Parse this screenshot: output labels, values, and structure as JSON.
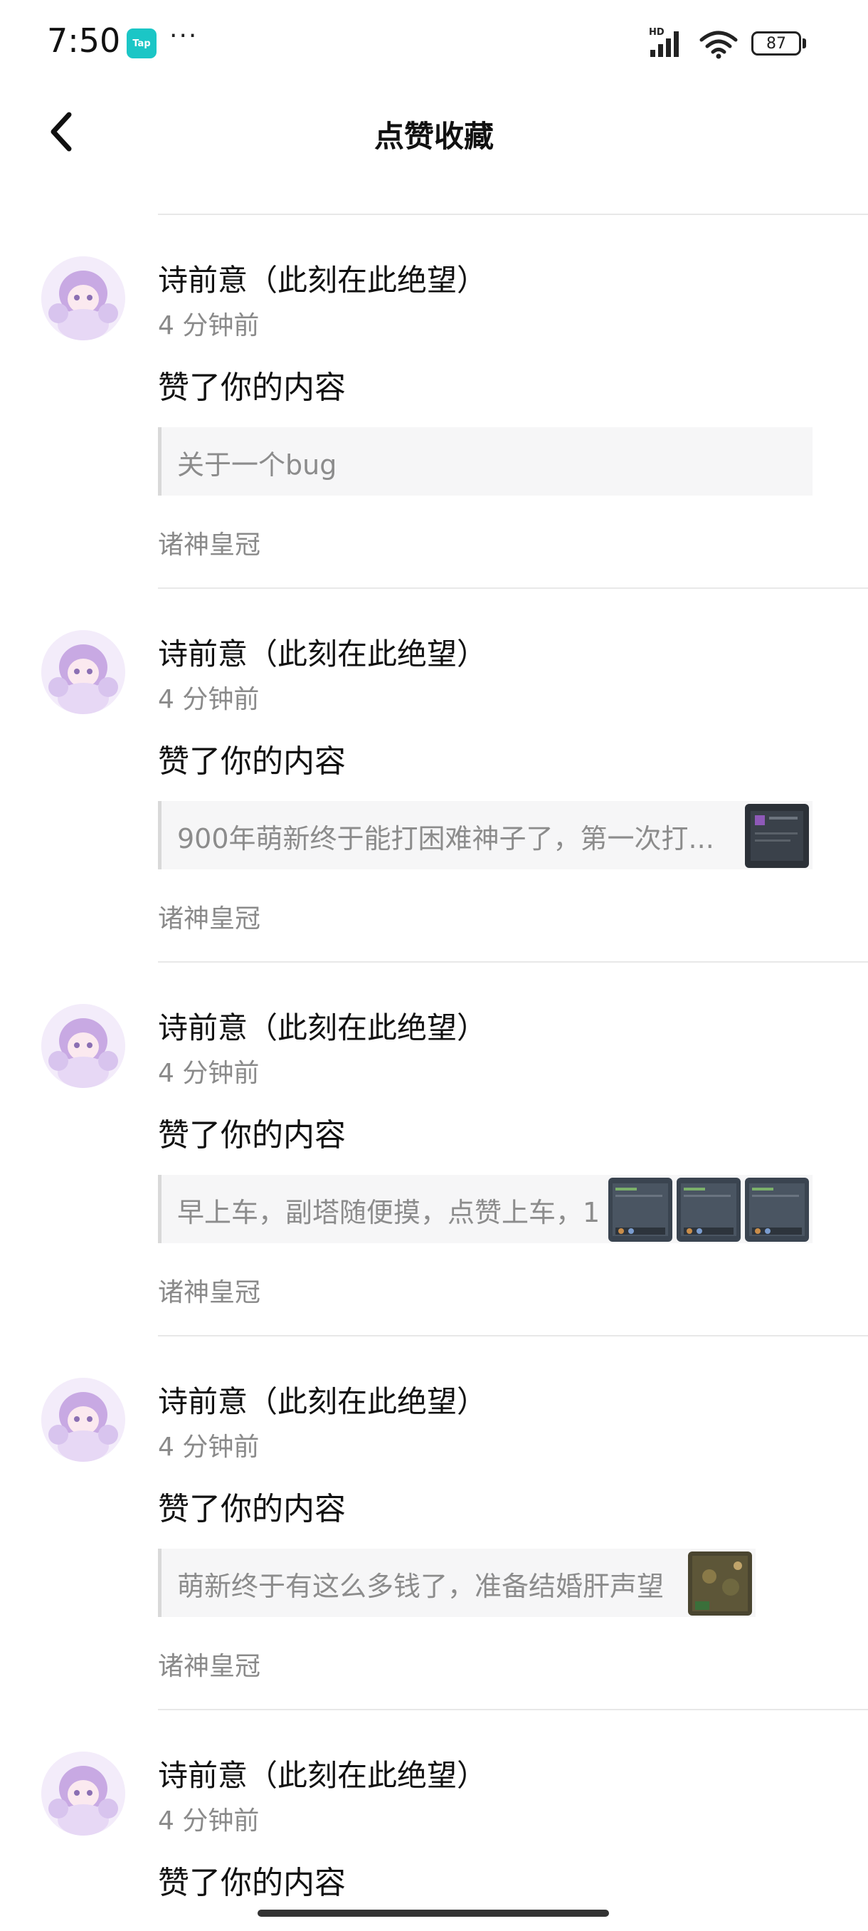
{
  "status_bar": {
    "time": "7:50",
    "app_badge": "Tap",
    "more": "···",
    "signal_label": "HD",
    "battery": "87"
  },
  "header": {
    "title": "点赞收藏"
  },
  "notifications": [
    {
      "user": "诗前意（此刻在此绝望）",
      "time": "4 分钟前",
      "action": "赞了你的内容",
      "quote": "关于一个bug",
      "game": "诸神皇冠",
      "thumbs": 0
    },
    {
      "user": "诗前意（此刻在此绝望）",
      "time": "4 分钟前",
      "action": "赞了你的内容",
      "quote": "900年萌新终于能打困难神子了，第一次打...",
      "game": "诸神皇冠",
      "thumbs": 1
    },
    {
      "user": "诗前意（此刻在此绝望）",
      "time": "4 分钟前",
      "action": "赞了你的内容",
      "quote": "早上车，副塔随便摸，点赞上车，1",
      "game": "诸神皇冠",
      "thumbs": 3
    },
    {
      "user": "诗前意（此刻在此绝望）",
      "time": "4 分钟前",
      "action": "赞了你的内容",
      "quote": "萌新终于有这么多钱了，准备结婚肝声望",
      "game": "诸神皇冠",
      "thumbs": 1
    },
    {
      "user": "诗前意（此刻在此绝望）",
      "time": "4 分钟前",
      "action": "赞了你的内容"
    }
  ]
}
